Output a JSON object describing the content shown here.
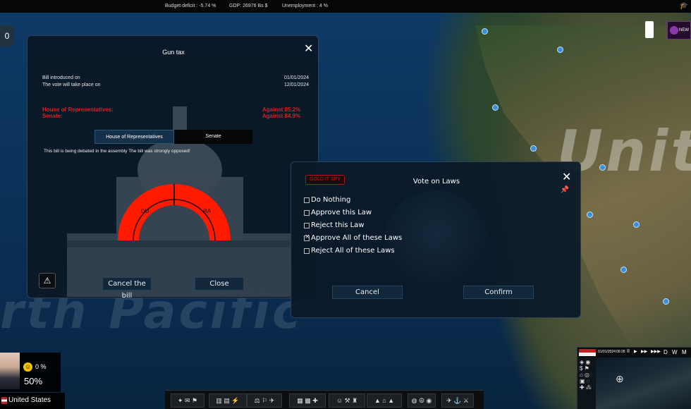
{
  "topbar": {
    "budget_label": "Budget deficit :",
    "budget_value": "-5.74 %",
    "gdp_label": "GDP:",
    "gdp_value": "26976 Bs $",
    "unemployment_label": "Unemployment :",
    "unemployment_value": "4 %"
  },
  "map": {
    "country_label": "Unit",
    "ocean_label": "rth Pacific"
  },
  "left_badge": "0",
  "news_badge": "NEW",
  "bill": {
    "title": "Gun tax",
    "introduced_label": "Bill introduced on",
    "introduced_date": "01/01/2024",
    "vote_label": "The vote will take place on",
    "vote_date": "12/01/2024",
    "house_label": "House of Representatives:",
    "house_result": "Against 85.2%",
    "senate_label": "Senate:",
    "senate_result": "Against 84.9%",
    "tabs": [
      "House of Representatives",
      "Senate"
    ],
    "debate_text": "This bill is being debated in the assembly The bill was strongly opposed!",
    "hemicycle": {
      "left_party": "DU",
      "right_party": "RA",
      "color": "#ff1a00"
    },
    "cancel_label": "Cancel the bill",
    "close_label": "Close"
  },
  "vote": {
    "logo_text": "GOLD IT SPY",
    "title": "Vote on Laws",
    "options": [
      {
        "label": "Do Nothing",
        "checked": false
      },
      {
        "label": "Approve this Law",
        "checked": false
      },
      {
        "label": "Reject this Law",
        "checked": false
      },
      {
        "label": "Approve All of these Laws",
        "checked": true
      },
      {
        "label": "Reject All of these Laws",
        "checked": false
      }
    ],
    "cancel_label": "Cancel",
    "confirm_label": "Confirm"
  },
  "leader": {
    "approval_value": "0 %",
    "popularity": "50%"
  },
  "country": {
    "name": "United States"
  },
  "minimap": {
    "date": "01/01/2024",
    "time": "00:28",
    "speeds": [
      "II",
      "▶",
      "▶▶",
      "▶▶▶",
      "D",
      "W",
      "M"
    ]
  }
}
